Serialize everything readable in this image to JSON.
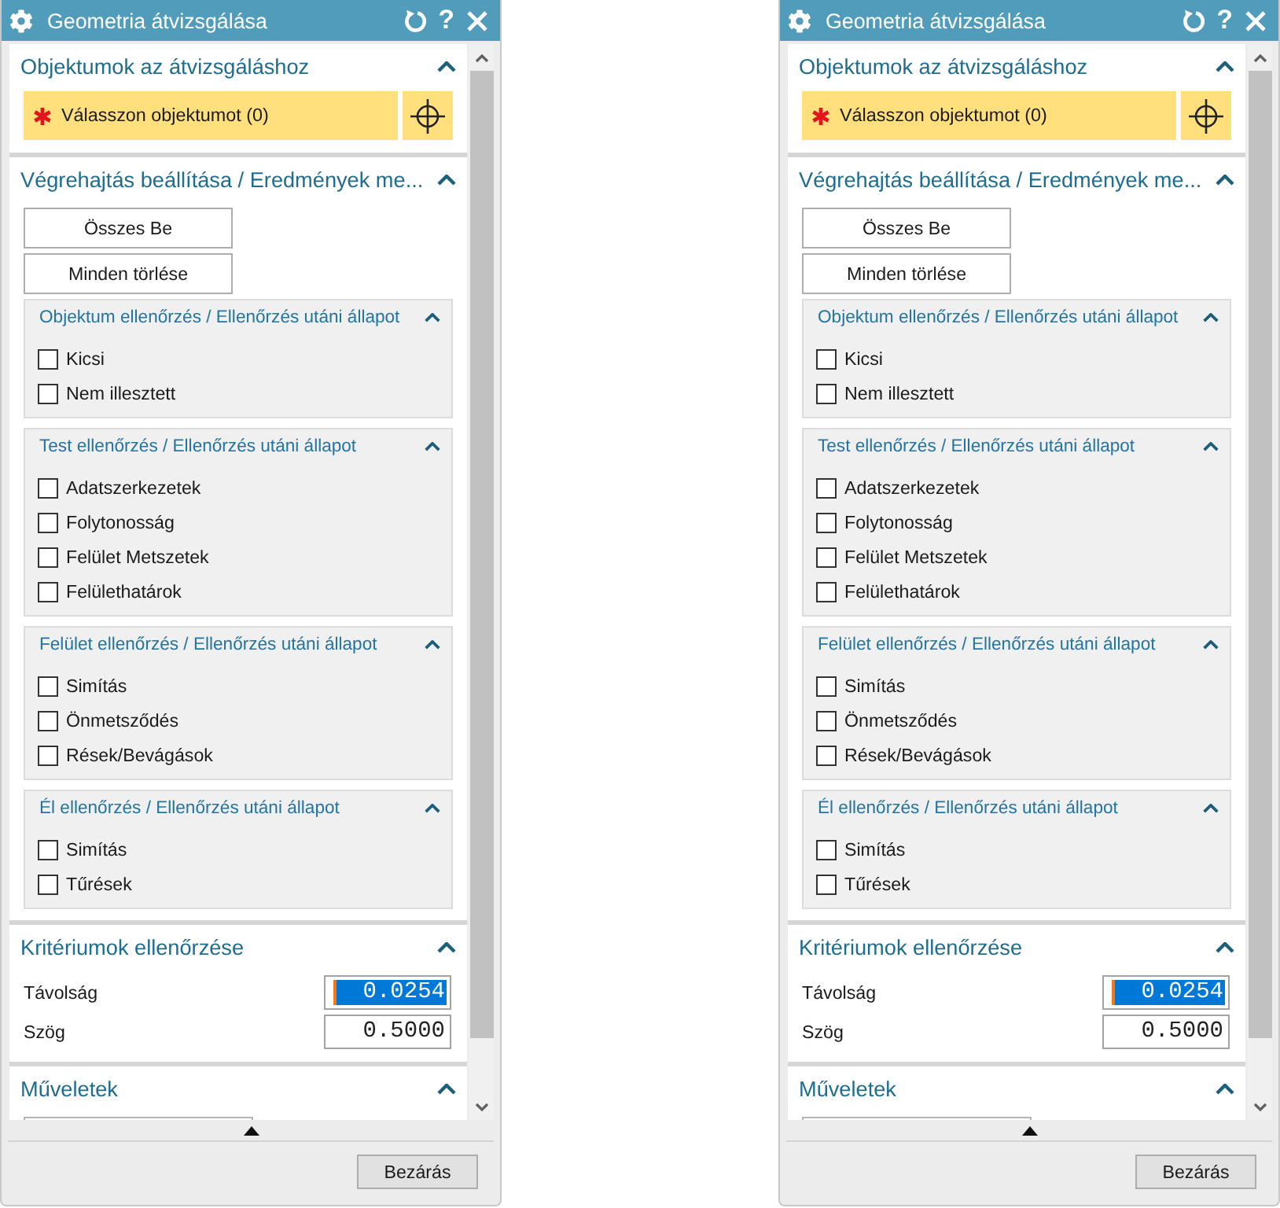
{
  "dialogs": [
    {
      "title": "Geometria átvizsgálása",
      "help_label": "?",
      "sections": [
        {
          "kind": "selection",
          "title": "Objektumok az átvizsgáláshoz",
          "expanded": true,
          "selection": {
            "label": "Válasszon objektumot (0)",
            "required": true
          }
        },
        {
          "kind": "options",
          "title": "Végrehajtás beállítása / Eredmények me...",
          "expanded": true,
          "buttons": [
            "Összes Be",
            "Minden törlése"
          ],
          "groups": [
            {
              "title": "Objektum ellenőrzés / Ellenőrzés utáni állapot",
              "expanded": true,
              "items": [
                {
                  "label": "Kicsi",
                  "checked": false
                },
                {
                  "label": "Nem illesztett",
                  "checked": false
                }
              ]
            },
            {
              "title": "Test ellenőrzés / Ellenőrzés utáni állapot",
              "expanded": true,
              "items": [
                {
                  "label": "Adatszerkezetek",
                  "checked": false
                },
                {
                  "label": "Folytonosság",
                  "checked": false
                },
                {
                  "label": "Felület Metszetek",
                  "checked": false
                },
                {
                  "label": "Felülethatárok",
                  "checked": false
                }
              ]
            },
            {
              "title": "Felület ellenőrzés / Ellenőrzés utáni állapot",
              "expanded": true,
              "items": [
                {
                  "label": "Simítás",
                  "checked": false
                },
                {
                  "label": "Önmetsződés",
                  "checked": false
                },
                {
                  "label": "Rések/Bevágások",
                  "checked": false
                }
              ]
            },
            {
              "title": "Él ellenőrzés / Ellenőrzés utáni állapot",
              "expanded": true,
              "items": [
                {
                  "label": "Simítás",
                  "checked": false
                },
                {
                  "label": "Tűrések",
                  "checked": false
                }
              ]
            }
          ]
        },
        {
          "kind": "criteria",
          "title": "Kritériumok ellenőrzése",
          "expanded": true,
          "fields": [
            {
              "label": "Távolság",
              "value": "0.0254",
              "focused": true
            },
            {
              "label": "Szög",
              "value": "0.5000",
              "focused": false
            }
          ]
        },
        {
          "kind": "actions",
          "title": "Műveletek",
          "expanded": true
        }
      ],
      "footer_buttons": [
        "Bezárás"
      ]
    },
    {
      "title": "Geometria átvizsgálása",
      "help_label": "?",
      "sections": [
        {
          "kind": "selection",
          "title": "Objektumok az átvizsgáláshoz",
          "expanded": true,
          "selection": {
            "label": "Válasszon objektumot (0)",
            "required": true
          }
        },
        {
          "kind": "options",
          "title": "Végrehajtás beállítása / Eredmények me...",
          "expanded": true,
          "buttons": [
            "Összes Be",
            "Minden törlése"
          ],
          "groups": [
            {
              "title": "Objektum ellenőrzés / Ellenőrzés utáni állapot",
              "expanded": true,
              "items": [
                {
                  "label": "Kicsi",
                  "checked": false
                },
                {
                  "label": "Nem illesztett",
                  "checked": false
                }
              ]
            },
            {
              "title": "Test ellenőrzés / Ellenőrzés utáni állapot",
              "expanded": true,
              "items": [
                {
                  "label": "Adatszerkezetek",
                  "checked": false
                },
                {
                  "label": "Folytonosság",
                  "checked": false
                },
                {
                  "label": "Felület Metszetek",
                  "checked": false
                },
                {
                  "label": "Felülethatárok",
                  "checked": false
                }
              ]
            },
            {
              "title": "Felület ellenőrzés / Ellenőrzés utáni állapot",
              "expanded": true,
              "items": [
                {
                  "label": "Simítás",
                  "checked": false
                },
                {
                  "label": "Önmetsződés",
                  "checked": false
                },
                {
                  "label": "Rések/Bevágások",
                  "checked": false
                }
              ]
            },
            {
              "title": "Él ellenőrzés / Ellenőrzés utáni állapot",
              "expanded": true,
              "items": [
                {
                  "label": "Simítás",
                  "checked": false
                },
                {
                  "label": "Tűrések",
                  "checked": false
                }
              ]
            }
          ]
        },
        {
          "kind": "criteria",
          "title": "Kritériumok ellenőrzése",
          "expanded": true,
          "fields": [
            {
              "label": "Távolság",
              "value": "0.0254",
              "focused": true
            },
            {
              "label": "Szög",
              "value": "0.5000",
              "focused": false
            }
          ]
        },
        {
          "kind": "actions",
          "title": "Műveletek",
          "expanded": true
        }
      ],
      "footer_buttons": [
        "Bezárás"
      ]
    }
  ]
}
